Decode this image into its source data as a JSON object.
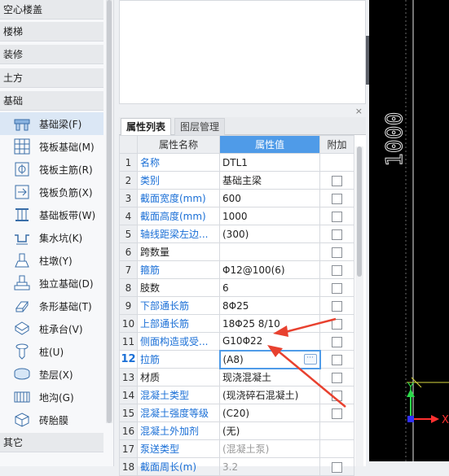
{
  "sidebar": {
    "categories": {
      "c0": "空心楼盖",
      "c1": "楼梯",
      "c2": "装修",
      "c3": "土方",
      "c4": "基础",
      "c5": "其它"
    },
    "items": [
      {
        "label": "基础梁(F)",
        "icon": "foundation-beam-icon"
      },
      {
        "label": "筏板基础(M)",
        "icon": "raft-foundation-icon"
      },
      {
        "label": "筏板主筋(R)",
        "icon": "raft-main-rebar-icon"
      },
      {
        "label": "筏板负筋(X)",
        "icon": "raft-negative-rebar-icon"
      },
      {
        "label": "基础板带(W)",
        "icon": "foundation-slab-strip-icon"
      },
      {
        "label": "集水坑(K)",
        "icon": "sump-pit-icon"
      },
      {
        "label": "柱墩(Y)",
        "icon": "column-pier-icon"
      },
      {
        "label": "独立基础(D)",
        "icon": "isolated-foundation-icon"
      },
      {
        "label": "条形基础(T)",
        "icon": "strip-foundation-icon"
      },
      {
        "label": "桩承台(V)",
        "icon": "pile-cap-icon"
      },
      {
        "label": "桩(U)",
        "icon": "pile-icon"
      },
      {
        "label": "垫层(X)",
        "icon": "cushion-layer-icon"
      },
      {
        "label": "地沟(G)",
        "icon": "trench-icon"
      },
      {
        "label": "砖胎膜",
        "icon": "brick-mold-icon"
      }
    ]
  },
  "panel": {
    "close_glyph": "×",
    "tabs": {
      "properties": "属性列表",
      "layers": "图层管理"
    },
    "headers": {
      "name": "属性名称",
      "value": "属性值",
      "extra": "附加"
    },
    "rows": [
      {
        "n": "1",
        "name": "名称",
        "value": "DTL1",
        "chk": false
      },
      {
        "n": "2",
        "name": "类别",
        "value": "基础主梁",
        "chk": true
      },
      {
        "n": "3",
        "name": "截面宽度(mm)",
        "value": "600",
        "chk": true
      },
      {
        "n": "4",
        "name": "截面高度(mm)",
        "value": "1000",
        "chk": true
      },
      {
        "n": "5",
        "name": "轴线距梁左边...",
        "value": "(300)",
        "chk": true
      },
      {
        "n": "6",
        "name": "跨数量",
        "value": "",
        "chk": true
      },
      {
        "n": "7",
        "name": "箍筋",
        "value": "Φ12@100(6)",
        "chk": true
      },
      {
        "n": "8",
        "name": "肢数",
        "value": "6",
        "chk": true
      },
      {
        "n": "9",
        "name": "下部通长筋",
        "value": "8Φ25",
        "chk": true
      },
      {
        "n": "10",
        "name": "上部通长筋",
        "value": "18Φ25 8/10",
        "chk": true
      },
      {
        "n": "11",
        "name": "侧面构造或受...",
        "value": "G10Φ22",
        "chk": true
      },
      {
        "n": "12",
        "name": "拉筋",
        "value": "(A8)",
        "chk": true
      },
      {
        "n": "13",
        "name": "材质",
        "value": "现浇混凝土",
        "chk": true
      },
      {
        "n": "14",
        "name": "混凝土类型",
        "value": "(现浇碎石混凝土)",
        "chk": true
      },
      {
        "n": "15",
        "name": "混凝土强度等级",
        "value": "(C20)",
        "chk": true
      },
      {
        "n": "16",
        "name": "混凝土外加剂",
        "value": "(无)",
        "chk": false
      },
      {
        "n": "17",
        "name": "泵送类型",
        "value": "(混凝土泵)",
        "chk": false
      },
      {
        "n": "18",
        "name": "截面周长(m)",
        "value": "3.2",
        "chk": true
      }
    ],
    "dots_glyph": "···"
  },
  "canvas": {
    "dimension_text": "1000",
    "axis_y": "Y",
    "axis_x": "X"
  },
  "colors": {
    "accent": "#4f9be8",
    "link_text": "#1a6fd6",
    "arrow": "#e8412f",
    "canvas_bg": "#000000",
    "axis_green": "#2bd94a",
    "axis_red": "#ff3030"
  }
}
